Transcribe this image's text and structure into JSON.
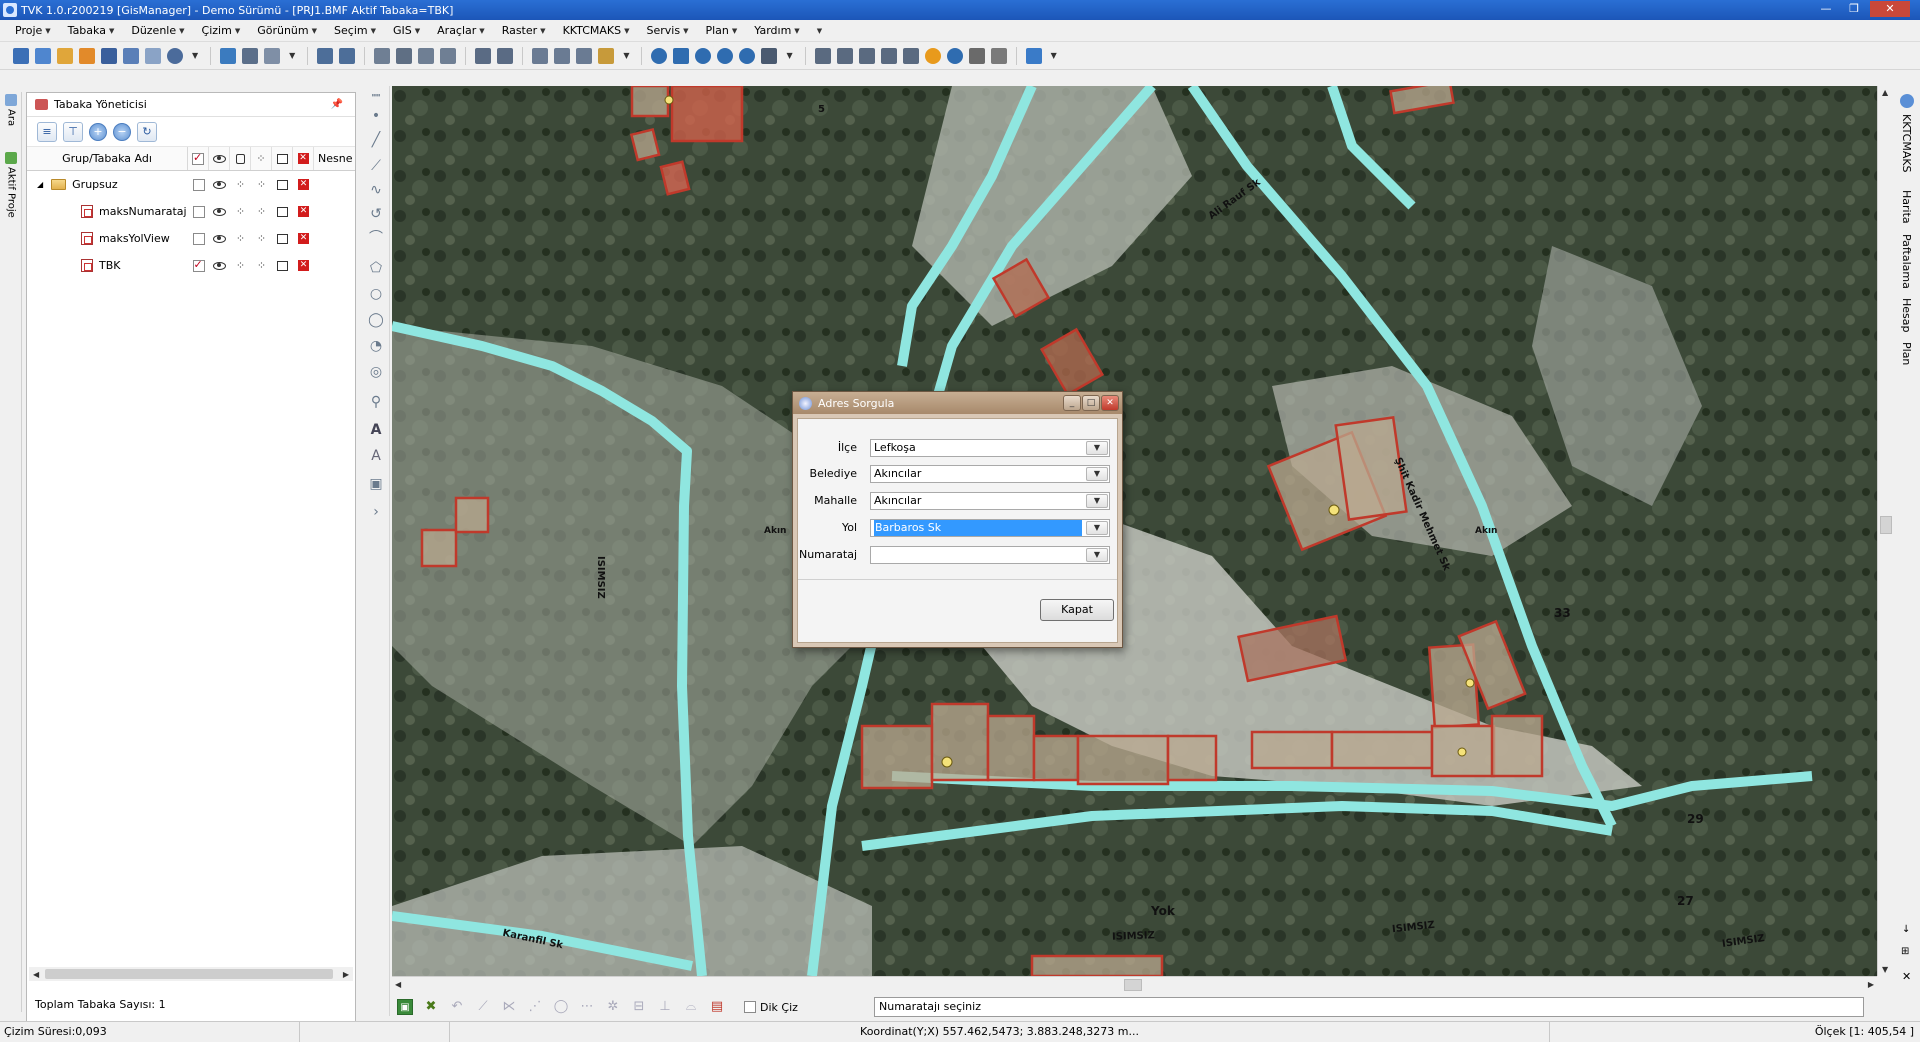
{
  "window": {
    "title": "TVK 1.0.r200219 [GisManager] - Demo Sürümü - [PRJ1.BMF  Aktif Tabaka=TBK]"
  },
  "menu": [
    "Proje",
    "Tabaka",
    "Düzenle",
    "Çizim",
    "Görünüm",
    "Seçim",
    "GIS",
    "Araçlar",
    "Raster",
    "KKTCMAKS",
    "Servis",
    "Plan",
    "Yardım"
  ],
  "left_tabs": {
    "ara": "Ara",
    "aktif_proje": "Aktif Proje"
  },
  "layer_panel": {
    "title": "Tabaka Yöneticisi",
    "col_name": "Grup/Tabaka Adı",
    "col_nesne": "Nesne",
    "group": {
      "name": "Grupsuz",
      "visible": false
    },
    "layers": [
      {
        "name": "maksNumarataj",
        "visible": false
      },
      {
        "name": "maksYolView",
        "visible": false
      },
      {
        "name": "TBK",
        "visible": true
      }
    ],
    "total": "Toplam Tabaka Sayısı: 1"
  },
  "right_tabs": [
    "KKTCMAKS",
    "Harita",
    "Paftalama",
    "Hesap",
    "Plan"
  ],
  "map": {
    "street_labels": [
      "Ali Rauf Sk",
      "Şhit Kadir Mehmet Sk",
      "ISIMSIZ",
      "Karanfil Sk",
      "ISIMSIZ",
      "ISIMSIZ",
      "ISIMSIZ",
      "Akın",
      "Akın"
    ],
    "numbers": [
      "5",
      "33",
      "29",
      "27"
    ],
    "yok": "Yok"
  },
  "dialog": {
    "title": "Adres Sorgula",
    "fields": [
      {
        "label": "İlçe",
        "value": "Lefkoşa"
      },
      {
        "label": "Belediye",
        "value": "Akıncılar"
      },
      {
        "label": "Mahalle",
        "value": "Akıncılar"
      },
      {
        "label": "Yol",
        "value": "Barbaros Sk"
      },
      {
        "label": "Numarataj",
        "value": ""
      }
    ],
    "close_button": "Kapat"
  },
  "edit_bar": {
    "dik_ciz": "Dik Çiz",
    "prompt": "Numaratajı seçiniz"
  },
  "status": {
    "cizim_suresi": "Çizim Süresi:0,093",
    "koordinat": "Koordinat(Y;X)  557.462,5473; 3.883.248,3273 m...",
    "olcek": "Ölçek [1: 405,54 ]"
  },
  "colors": {
    "title_bar": "#1c56b8",
    "road": "#8fe6e0",
    "building": "#c0392b",
    "dialog_frame": "#a7896b"
  }
}
